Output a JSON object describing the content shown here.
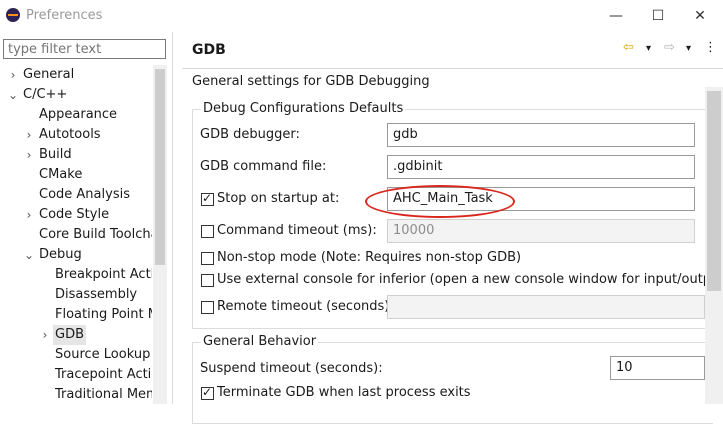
{
  "window": {
    "title": "Preferences",
    "minimize": "—",
    "maximize": "☐",
    "close": "✕"
  },
  "filter": {
    "placeholder": "type filter text"
  },
  "tree": [
    {
      "label": "General",
      "chevron": "›"
    },
    {
      "label": "C/C++",
      "chevron": "⌄"
    },
    {
      "label": "Appearance",
      "chevron": ""
    },
    {
      "label": "Autotools",
      "chevron": "›"
    },
    {
      "label": "Build",
      "chevron": "›"
    },
    {
      "label": "CMake",
      "chevron": ""
    },
    {
      "label": "Code Analysis",
      "chevron": ""
    },
    {
      "label": "Code Style",
      "chevron": "›"
    },
    {
      "label": "Core Build Toolcha",
      "chevron": ""
    },
    {
      "label": "Debug",
      "chevron": "⌄"
    },
    {
      "label": "Breakpoint Actio",
      "chevron": ""
    },
    {
      "label": "Disassembly",
      "chevron": ""
    },
    {
      "label": "Floating Point M",
      "chevron": ""
    },
    {
      "label": "GDB",
      "chevron": "›"
    },
    {
      "label": "Source Lookup P",
      "chevron": ""
    },
    {
      "label": "Tracepoint Actio",
      "chevron": ""
    },
    {
      "label": "Traditional Mem",
      "chevron": ""
    }
  ],
  "page": {
    "title": "GDB",
    "description": "General settings for GDB Debugging",
    "nav": {
      "back": "⇦",
      "back_menu": "▾",
      "forward": "⇨",
      "forward_menu": "▾",
      "menu": "⋮"
    }
  },
  "debug_defaults": {
    "title": "Debug Configurations Defaults",
    "gdb_debugger_label": "GDB debugger:",
    "gdb_debugger_value": "gdb",
    "gdb_command_file_label": "GDB command file:",
    "gdb_command_file_value": ".gdbinit",
    "stop_on_startup_label": "Stop on startup at:",
    "stop_on_startup_value": "AHC_Main_Task",
    "command_timeout_label": "Command timeout (ms):",
    "command_timeout_value": "10000",
    "non_stop_label": "Non-stop mode (Note: Requires non-stop GDB)",
    "external_console_label": "Use external console for inferior (open a new console window for input/output)",
    "remote_timeout_label": "Remote timeout (seconds):",
    "remote_timeout_value": ""
  },
  "general_behavior": {
    "title": "General Behavior",
    "suspend_timeout_label": "Suspend timeout (seconds):",
    "suspend_timeout_value": "10",
    "terminate_label": "Terminate GDB when last process exits"
  },
  "colors": {
    "annotation_oval": "#d8281e",
    "selection": "#e5e5e5"
  }
}
